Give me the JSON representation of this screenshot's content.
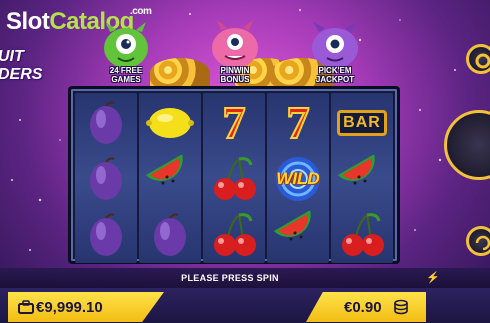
{
  "watermark": {
    "brand_part1": "Slot",
    "brand_part2": "Catalog",
    "tld": ".com"
  },
  "game_logo": {
    "line1": "UIT",
    "line2": "DERS"
  },
  "bonus_features": [
    {
      "line1": "24 FREE",
      "line2": "GAMES",
      "monster_color": "#62c43a"
    },
    {
      "line1": "PINWIN",
      "line2": "BONUS",
      "monster_color": "#ec6aa8"
    },
    {
      "line1": "PICK'EM",
      "line2": "JACKPOT",
      "monster_color": "#9a5ad8"
    }
  ],
  "reels": [
    [
      "plum",
      "plum",
      "plum"
    ],
    [
      "lemon",
      "watermelon",
      "plum"
    ],
    [
      "seven",
      "cherries",
      "cherries"
    ],
    [
      "seven",
      "wild",
      "watermelon"
    ],
    [
      "bar",
      "watermelon",
      "cherries"
    ]
  ],
  "symbols": {
    "seven": "7",
    "bar": "BAR",
    "wild": "WILD"
  },
  "status": {
    "message": "PLEASE PRESS SPIN"
  },
  "balance": {
    "value": "€9,999.10",
    "icon": "briefcase-icon"
  },
  "bet": {
    "value": "€0.90",
    "icon": "coins-icon"
  },
  "colors": {
    "accent": "#f2bd13",
    "background": "#a53bb8",
    "reel_bg": "#27356f"
  }
}
